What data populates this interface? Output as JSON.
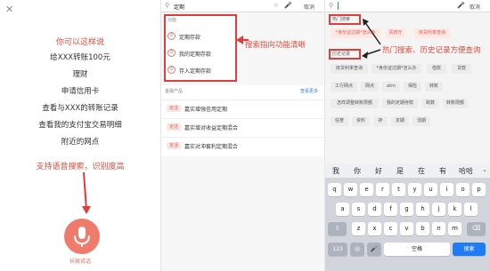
{
  "left": {
    "intro": "你可以这样说",
    "examples": [
      "给XXX转账100元",
      "理财",
      "申请信用卡",
      "查看与XXX的转账记录",
      "查看我的支付宝交易明细",
      "附近的网点"
    ],
    "voice_note": "支持语音搜索，识别度高",
    "mic_label": "长按说话"
  },
  "middle": {
    "search_value": "定期",
    "cancel": "取消",
    "section_function": "功能",
    "functions": [
      "定期存款",
      "我的定期存款",
      "存入定期存款"
    ],
    "annotation": "搜索指向功能清晰",
    "section_finance": "金融产品",
    "see_more": "查看更多",
    "products": [
      {
        "tag": "定活",
        "name": "嘉实增强信用定期"
      },
      {
        "tag": "定活",
        "name": "嘉实增对收益定期混合"
      },
      {
        "tag": "定活",
        "name": "嘉实对冲套利定期混合"
      }
    ]
  },
  "right": {
    "search_placeholder": "",
    "cancel": "取消",
    "hot_label": "热门搜索",
    "hot": [
      "*身份证过期*怎么办",
      "贵宾厅",
      "房贷利率查询"
    ],
    "annotation": "热门搜索、历史记录方便查询",
    "history_label": "历史记录",
    "history": [
      "房贷利率查询",
      "*身份证过期*怎么办",
      "借款",
      "贷款",
      "工行网点",
      "网点",
      "atm",
      "保险",
      "转账",
      "怎样调整转账限额",
      "我的定期存款",
      "跨数",
      "转账限额",
      "信誉",
      "资料",
      "存",
      "定期",
      "活期"
    ],
    "candidates": [
      "我",
      "你",
      "好",
      "是",
      "在",
      "有",
      "哈哈"
    ],
    "keys_row1": [
      "q",
      "w",
      "e",
      "r",
      "t",
      "y",
      "u",
      "i",
      "o",
      "p"
    ],
    "keys_row2": [
      "a",
      "s",
      "d",
      "f",
      "g",
      "h",
      "j",
      "k",
      "l"
    ],
    "keys_row3": [
      "z",
      "x",
      "c",
      "v",
      "b",
      "n",
      "m"
    ],
    "num_key": "123",
    "space_key": "空格",
    "search_key": "搜索"
  },
  "colors": {
    "accent_red": "#e24b3d",
    "key_blue": "#1f7cf2"
  }
}
